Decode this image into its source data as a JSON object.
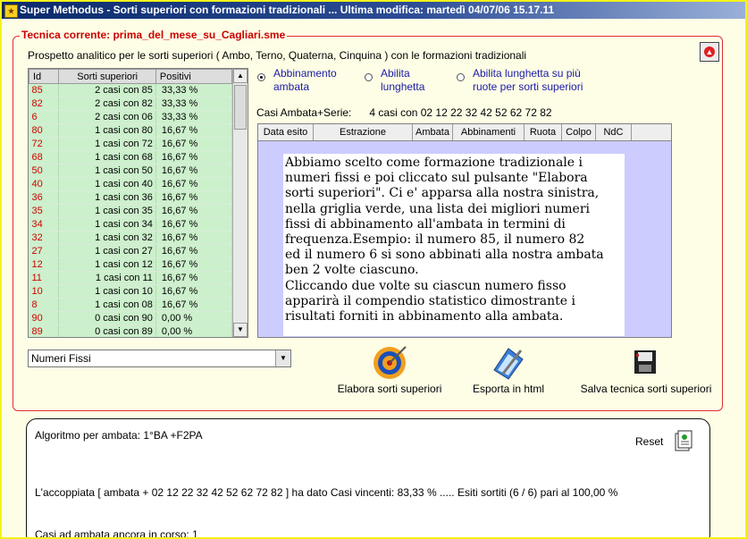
{
  "window": {
    "title": "Super Methodus - Sorti superiori con formazioni tradizionali ... Ultima modifica: martedì 04/07/06 15.17.11"
  },
  "technique": {
    "label": "Tecnica corrente: prima_del_mese_su_Cagliari.sme"
  },
  "subtitle": "Prospetto analitico per le sorti superiori ( Ambo, Terno, Quaterna, Cinquina ) con le formazioni tradizionali",
  "left_grid": {
    "headers": [
      "Id",
      "Sorti superiori",
      "Positivi"
    ],
    "rows": [
      {
        "id": "85",
        "sorti": "2 casi con 85",
        "pos": "33,33 %"
      },
      {
        "id": "82",
        "sorti": "2 casi con 82",
        "pos": "33,33 %"
      },
      {
        "id": "6",
        "sorti": "2 casi con 06",
        "pos": "33,33 %"
      },
      {
        "id": "80",
        "sorti": "1 casi con 80",
        "pos": "16,67 %"
      },
      {
        "id": "72",
        "sorti": "1 casi con 72",
        "pos": "16,67 %"
      },
      {
        "id": "68",
        "sorti": "1 casi con 68",
        "pos": "16,67 %"
      },
      {
        "id": "50",
        "sorti": "1 casi con 50",
        "pos": "16,67 %"
      },
      {
        "id": "40",
        "sorti": "1 casi con 40",
        "pos": "16,67 %"
      },
      {
        "id": "36",
        "sorti": "1 casi con 36",
        "pos": "16,67 %"
      },
      {
        "id": "35",
        "sorti": "1 casi con 35",
        "pos": "16,67 %"
      },
      {
        "id": "34",
        "sorti": "1 casi con 34",
        "pos": "16,67 %"
      },
      {
        "id": "32",
        "sorti": "1 casi con 32",
        "pos": "16,67 %"
      },
      {
        "id": "27",
        "sorti": "1 casi con 27",
        "pos": "16,67 %"
      },
      {
        "id": "12",
        "sorti": "1 casi con 12",
        "pos": "16,67 %"
      },
      {
        "id": "11",
        "sorti": "1 casi con 11",
        "pos": "16,67 %"
      },
      {
        "id": "10",
        "sorti": "1 casi con 10",
        "pos": "16,67 %"
      },
      {
        "id": "8",
        "sorti": "1 casi con 08",
        "pos": "16,67 %"
      },
      {
        "id": "90",
        "sorti": "0 casi con 90",
        "pos": "0,00 %"
      },
      {
        "id": "89",
        "sorti": "0 casi con 89",
        "pos": "0,00 %"
      }
    ]
  },
  "options": {
    "opt1": {
      "line1": "Abbinamento",
      "line2": "ambata"
    },
    "opt2": {
      "line1": "Abilita",
      "line2": "lunghetta"
    },
    "opt3": {
      "line1": "Abilita lunghetta su più",
      "line2": "ruote per sorti superiori"
    }
  },
  "casi": {
    "label": "Casi Ambata+Serie:",
    "value": "4 casi con 02 12 22 32 42 52 62 72 82"
  },
  "right_grid": {
    "headers": [
      "Data esito",
      "Estrazione",
      "Ambata",
      "Abbinamenti",
      "Ruota",
      "Colpo",
      "NdC"
    ]
  },
  "note": {
    "lines": [
      "Abbiamo scelto come formazione tradizionale i",
      "numeri fissi e poi cliccato sul pulsante \"Elabora",
      "sorti superiori\". Ci e' apparsa alla nostra sinistra,",
      "nella griglia verde, una lista dei migliori numeri",
      "fissi  di abbinamento all'ambata in termini di",
      "frequenza.Esempio: il numero 85, il numero 82",
      "ed il numero 6 si sono abbinati alla nostra ambata",
      "ben 2 volte ciascuno.",
      "Cliccando due volte su ciascun numero fisso",
      "apparirà il compendio statistico dimostrante i",
      "risultati forniti in abbinamento alla ambata."
    ]
  },
  "combo": {
    "value": "Numeri Fissi"
  },
  "tools": {
    "elabora": "Elabora sorti superiori",
    "esporta": "Esporta in html",
    "salva": "Salva tecnica sorti superiori"
  },
  "result": {
    "algoritmo": "Algoritmo per ambata: 1°BA +F2PA",
    "reset": "Reset",
    "accoppiata": "L'accoppiata [ ambata + 02 12 22 32 42 52 62 72 82 ] ha dato  Casi vincenti: 83,33 % ..... Esiti sortiti (6 / 6) pari al 100,00 %",
    "in_corso": "Casi ad ambata ancora in corso: 1"
  }
}
